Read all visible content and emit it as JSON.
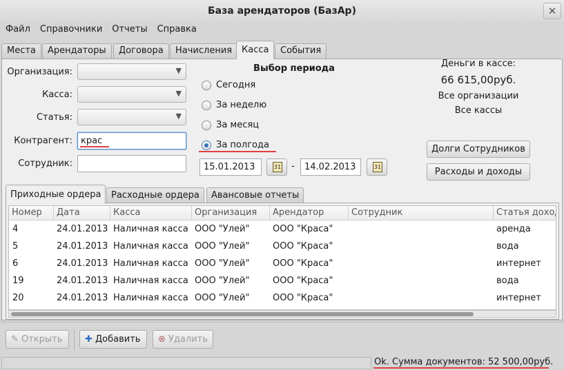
{
  "window": {
    "title": "База арендаторов (БазАр)",
    "close_glyph": "✕"
  },
  "menu": [
    "Файл",
    "Справочники",
    "Отчеты",
    "Справка"
  ],
  "tabs": [
    "Места",
    "Арендаторы",
    "Договора",
    "Начисления",
    "Касса",
    "События"
  ],
  "active_tab": "Касса",
  "filters": {
    "organization_label": "Организация:",
    "cashbox_label": "Касса:",
    "article_label": "Статья:",
    "counterparty_label": "Контрагент:",
    "counterparty_value": "крас",
    "employee_label": "Сотрудник:",
    "employee_value": ""
  },
  "period": {
    "title": "Выбор периода",
    "options": [
      "Сегодня",
      "За неделю",
      "За месяц",
      "За полгода"
    ],
    "selected": "За полгода",
    "date_from": "15.01.2013",
    "date_separator": "-",
    "date_to": "14.02.2013",
    "calendar_icon_text": "31"
  },
  "cash": {
    "label": "Деньги в кассе:",
    "amount": "66 615,00руб.",
    "org_scope": "Все организации",
    "cashbox_scope": "Все кассы"
  },
  "actions": {
    "debts_button": "Долги Сотрудников",
    "income_expense_button": "Расходы и доходы"
  },
  "inner_tabs": [
    "Приходные ордера",
    "Расходные ордера",
    "Авансовые отчеты"
  ],
  "table": {
    "columns": [
      "Номер",
      "Дата",
      "Касса",
      "Организация",
      "Арендатор",
      "Сотрудник",
      "Статья доходов"
    ],
    "rows": [
      [
        "4",
        "24.01.2013",
        "Наличная касса",
        "ООО \"Улей\"",
        "ООО \"Краса\"",
        "",
        "аренда"
      ],
      [
        "5",
        "24.01.2013",
        "Наличная касса",
        "ООО \"Улей\"",
        "ООО \"Краса\"",
        "",
        "вода"
      ],
      [
        "6",
        "24.01.2013",
        "Наличная касса",
        "ООО \"Улей\"",
        "ООО \"Краса\"",
        "",
        "интернет"
      ],
      [
        "19",
        "24.01.2013",
        "Наличная касса",
        "ООО \"Улей\"",
        "ООО \"Краса\"",
        "",
        "вода"
      ],
      [
        "20",
        "24.01.2013",
        "Наличная касса",
        "ООО \"Улей\"",
        "ООО \"Краса\"",
        "",
        "интернет"
      ]
    ]
  },
  "toolbar": {
    "open_label": "Открыть",
    "add_label": "Добавить",
    "delete_label": "Удалить"
  },
  "status": {
    "text": "Ok. Сумма документов: 52 500,00руб."
  },
  "colors": {
    "accent": "#4a7fbf",
    "spellcheck": "#e04040"
  },
  "icons": [
    "close-icon",
    "chevron-down-icon",
    "calendar-icon",
    "edit-icon",
    "plus-icon",
    "delete-icon"
  ]
}
